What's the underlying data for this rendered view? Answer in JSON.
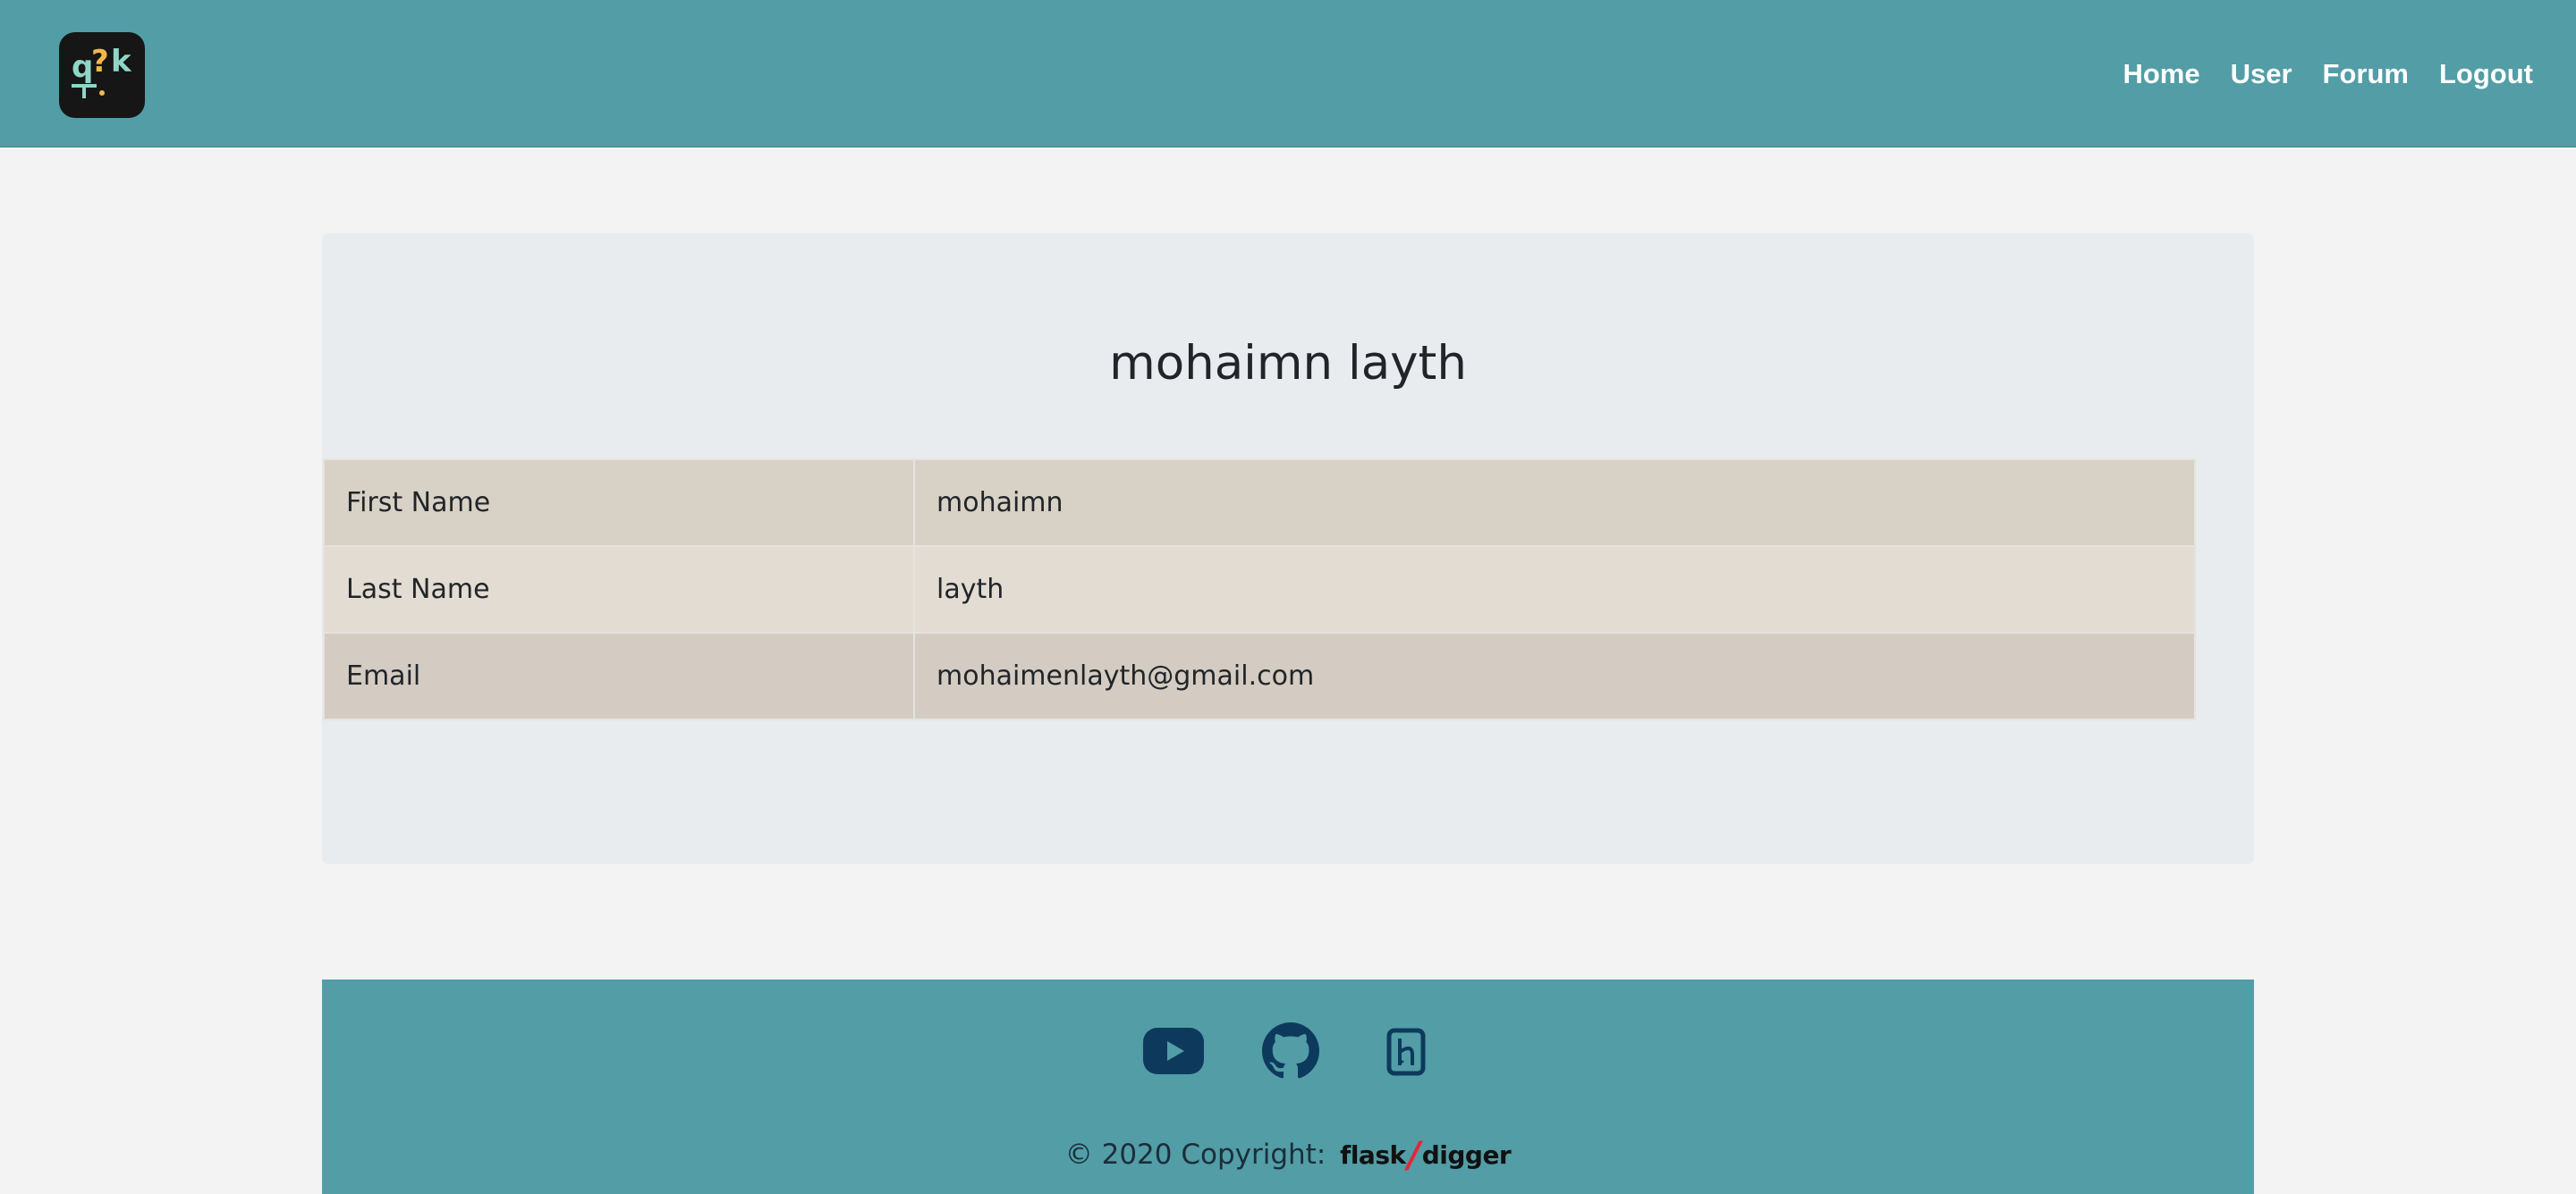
{
  "navbar": {
    "logo_text": "q?k",
    "links": [
      "Home",
      "User",
      "Forum",
      "Logout"
    ],
    "background_color": "#529da6"
  },
  "profile": {
    "title": "mohaimn layth",
    "rows": [
      {
        "label": "First Name",
        "value": "mohaimn"
      },
      {
        "label": "Last Name",
        "value": "layth"
      },
      {
        "label": "Email",
        "value": "mohaimenlayth@gmail.com"
      }
    ]
  },
  "footer": {
    "icons": [
      "youtube-icon",
      "github-icon",
      "heroku-icon"
    ],
    "copyright_text": "© 2020 Copyright:",
    "brand_left": "flask",
    "brand_slash": "/",
    "brand_right": "digger",
    "icon_color": "#0d3a5c"
  }
}
